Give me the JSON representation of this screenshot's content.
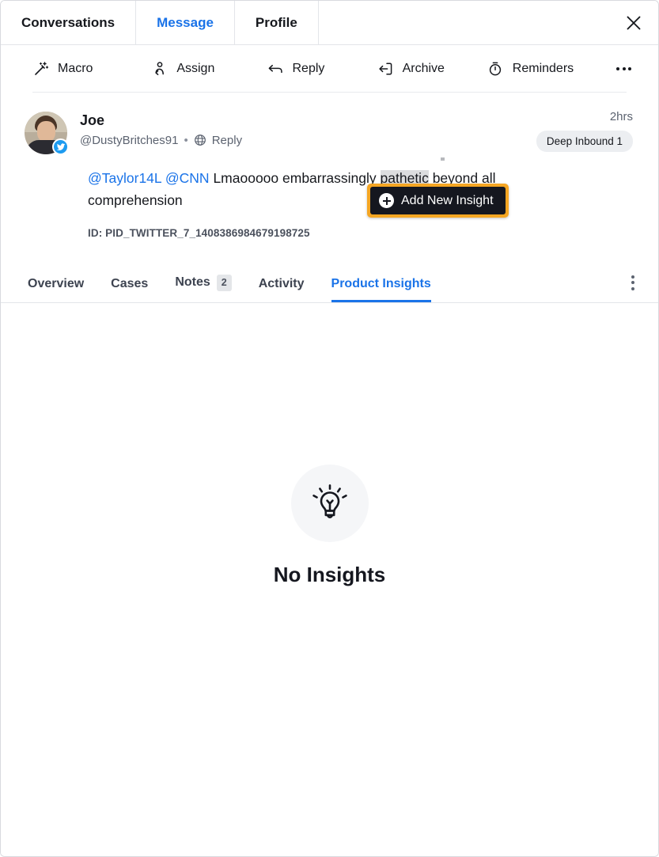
{
  "window": {
    "close_icon": "close-icon"
  },
  "top_tabs": [
    {
      "label": "Conversations",
      "active": false
    },
    {
      "label": "Message",
      "active": true
    },
    {
      "label": "Profile",
      "active": false
    }
  ],
  "toolbar": {
    "actions": [
      {
        "label": "Macro",
        "icon": "magic-wand-icon"
      },
      {
        "label": "Assign",
        "icon": "assign-person-icon"
      },
      {
        "label": "Reply",
        "icon": "reply-arrow-icon"
      },
      {
        "label": "Archive",
        "icon": "archive-box-icon"
      },
      {
        "label": "Reminders",
        "icon": "stopwatch-icon"
      }
    ],
    "more_icon": "more-horizontal-icon"
  },
  "message": {
    "sender_name": "Joe",
    "handle": "@DustyBritches91",
    "separator": "•",
    "channel_icon": "globe-icon",
    "channel_label": "Reply",
    "network_badge": "twitter-icon",
    "timestamp": "2hrs",
    "tag": "Deep Inbound 1",
    "body": {
      "mention_1": "@Taylor14L",
      "mention_2": "@CNN",
      "text_before": "Lmaooooo embarrassingly ",
      "selected": "pathetic",
      "text_after": " beyond all comprehension"
    },
    "id_label": "ID:",
    "id_value": "PID_TWITTER_7_1408386984679198725"
  },
  "insight_popover": {
    "label": "Add New Insight",
    "icon": "plus-circle-icon",
    "highlight_color": "#f5a623",
    "background_color": "#15171f"
  },
  "sub_tabs": [
    {
      "label": "Overview",
      "badge": null,
      "active": false
    },
    {
      "label": "Cases",
      "badge": null,
      "active": false
    },
    {
      "label": "Notes",
      "badge": "2",
      "active": false
    },
    {
      "label": "Activity",
      "badge": null,
      "active": false
    },
    {
      "label": "Product Insights",
      "badge": null,
      "active": true
    }
  ],
  "sub_tabs_menu_icon": "kebab-menu-icon",
  "empty_state": {
    "icon": "lightbulb-icon",
    "title": "No Insights"
  },
  "colors": {
    "accent_blue": "#1a73e8",
    "twitter_blue": "#1d9bf0",
    "highlight_orange": "#f5a623",
    "selection_grey": "#dcdddf"
  }
}
